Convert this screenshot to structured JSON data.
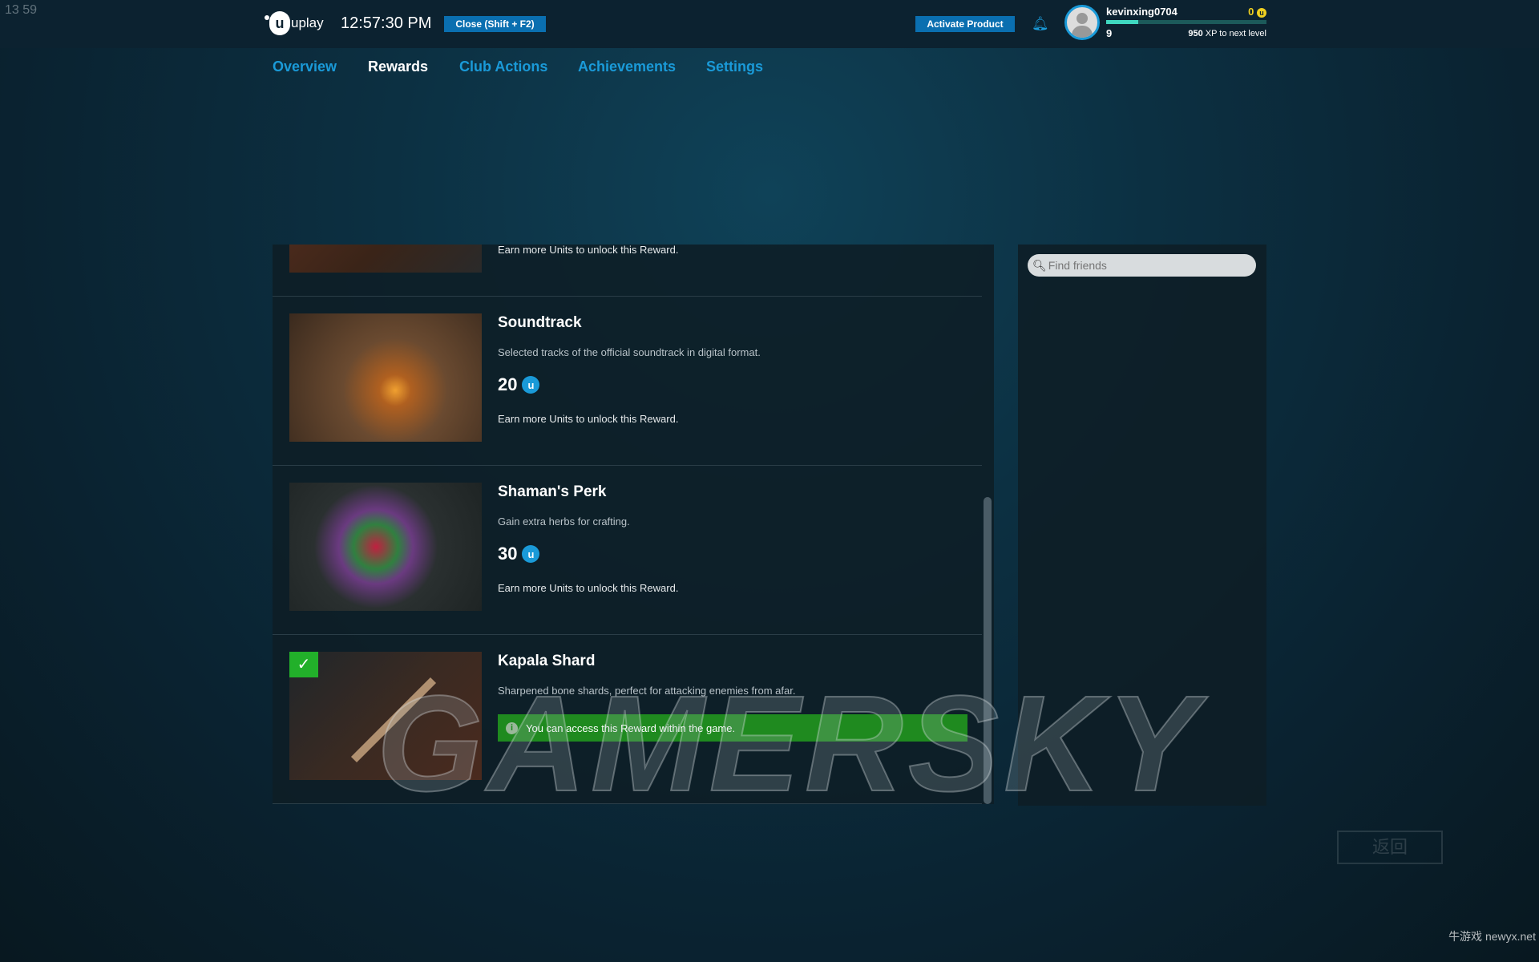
{
  "overlay": {
    "corner_text": "13 59",
    "back_button": "返回",
    "watermark": "GAMERSKY",
    "site_watermark": "牛游戏 newyx.net"
  },
  "topbar": {
    "logo": "uplay",
    "time": "12:57:30 PM",
    "close_label": "Close (Shift + F2)",
    "activate_label": "Activate Product",
    "user": {
      "name": "kevinxing0704",
      "units": "0",
      "level": "9",
      "xp_value": "950",
      "xp_text": "XP to next level",
      "xp_progress": 0.2
    }
  },
  "nav": {
    "tabs": [
      {
        "label": "Overview"
      },
      {
        "label": "Rewards",
        "active": true
      },
      {
        "label": "Club Actions"
      },
      {
        "label": "Achievements"
      },
      {
        "label": "Settings"
      }
    ]
  },
  "rewards": [
    {
      "earn": "Earn more Units to unlock this Reward."
    },
    {
      "title": "Soundtrack",
      "desc": "Selected tracks of the official soundtrack in digital format.",
      "price": "20",
      "earn": "Earn more Units to unlock this Reward."
    },
    {
      "title": "Shaman's Perk",
      "desc": "Gain extra herbs for crafting.",
      "price": "30",
      "earn": "Earn more Units to unlock this Reward."
    },
    {
      "title": "Kapala Shard",
      "desc": "Sharpened bone shards, perfect for attacking enemies from afar.",
      "unlocked": true,
      "notice": "You can access this Reward within the game."
    }
  ],
  "friends": {
    "search_placeholder": "Find friends"
  },
  "colors": {
    "accent": "#1a9ad8",
    "button": "#0a6fb0",
    "success": "#1f8a1f",
    "units": "#f0d020"
  }
}
